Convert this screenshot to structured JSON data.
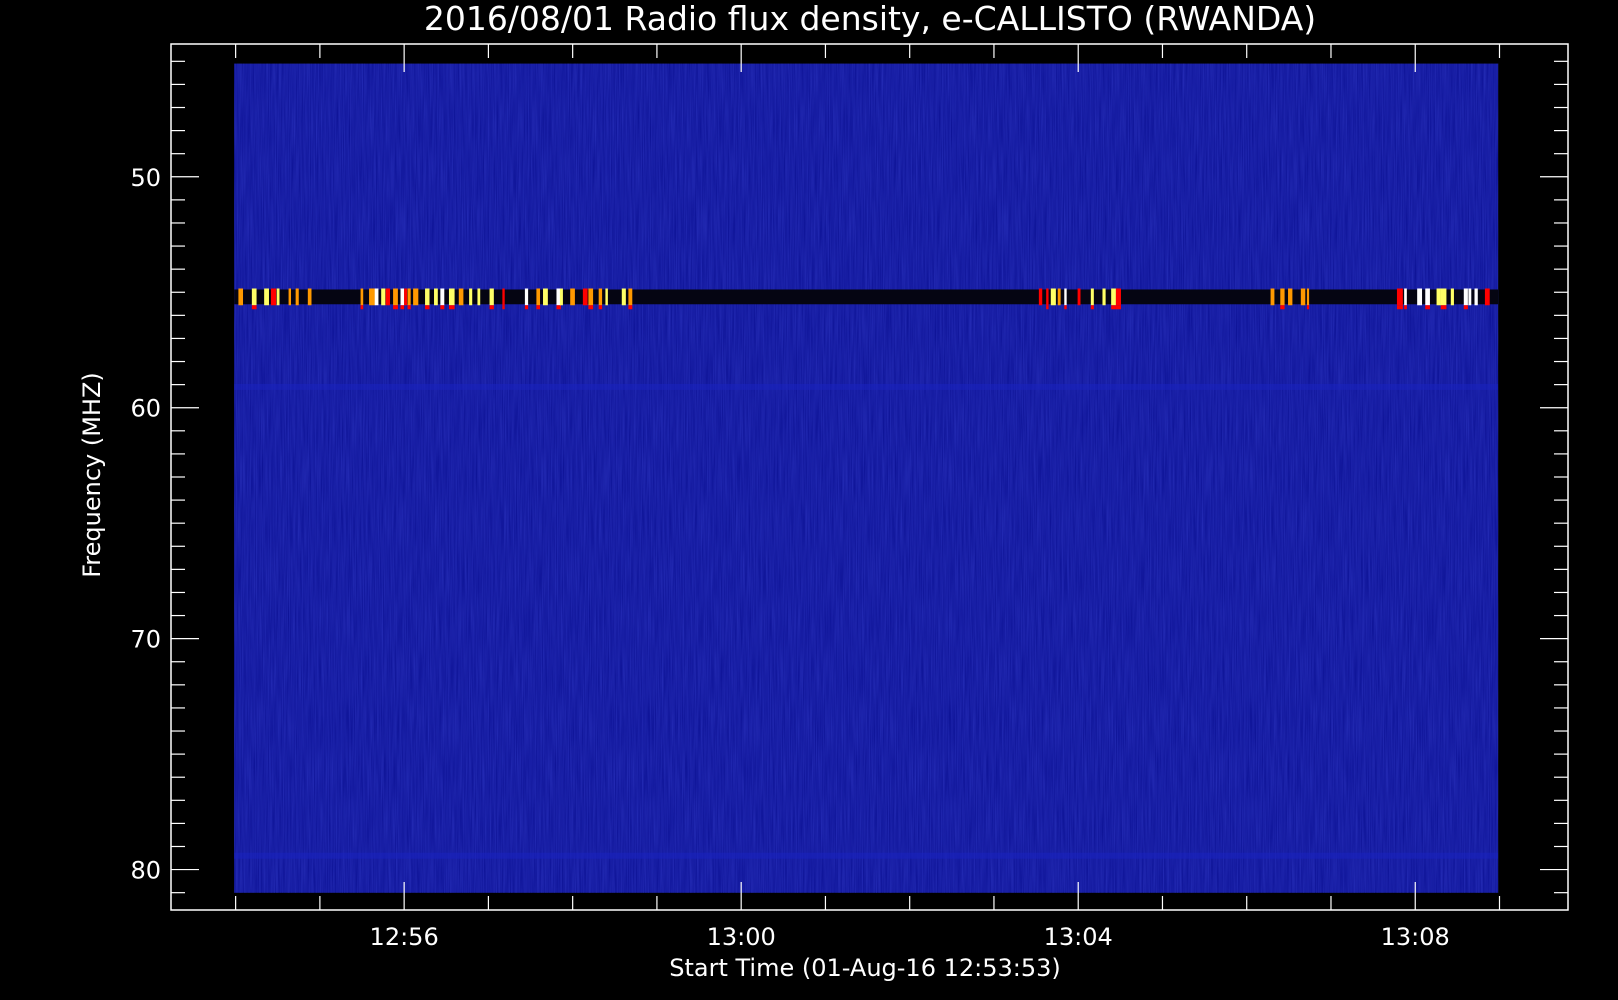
{
  "chart_data": {
    "type": "heatmap",
    "title": "2016/08/01  Radio flux density, e-CALLISTO (RWANDA)",
    "xlabel": "Start Time (01-Aug-16 12:53:53)",
    "ylabel": "Frequency (MHZ)",
    "x_ticks": [
      "12:56",
      "13:00",
      "13:04",
      "13:08"
    ],
    "y_ticks": [
      "50",
      "60",
      "70",
      "80"
    ],
    "x_tick_minutes": [
      2.117,
      6.117,
      10.117,
      14.117
    ],
    "x_range_minutes": [
      -0.65,
      15.93
    ],
    "y_range_mhz": [
      44.25,
      81.75
    ],
    "data_x_range_minutes": [
      0.1,
      15.1
    ],
    "data_y_range_mhz": [
      45.1,
      81.0
    ],
    "background_color": "#0a0f92",
    "burst_band": {
      "center_mhz": 55.2,
      "half_width_mhz": 0.32,
      "dark_color": "#050512",
      "spike_clusters_minutes": [
        [
          0.15,
          1.0
        ],
        [
          1.6,
          3.3
        ],
        [
          3.55,
          4.6
        ],
        [
          4.7,
          4.8
        ],
        [
          9.65,
          10.6
        ],
        [
          12.4,
          12.85
        ],
        [
          13.9,
          15.05
        ]
      ]
    },
    "faint_bands_mhz": [
      59.1,
      79.4
    ],
    "colormap": [
      "#0a0f92",
      "#ff0000",
      "#ff9900",
      "#ffff66",
      "#ffffff"
    ]
  }
}
